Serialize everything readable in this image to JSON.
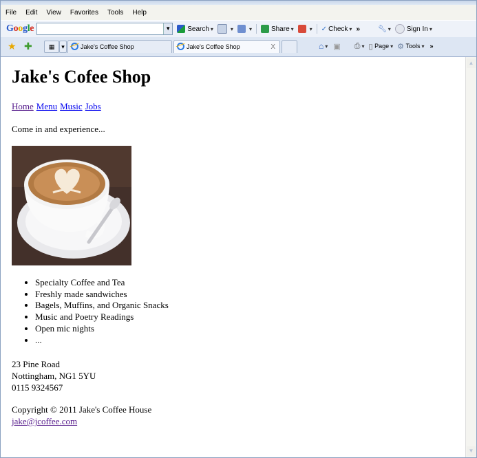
{
  "menu": [
    "File",
    "Edit",
    "View",
    "Favorites",
    "Tools",
    "Help"
  ],
  "google_toolbar": {
    "logo": [
      "G",
      "o",
      "o",
      "g",
      "l",
      "e"
    ],
    "search_label": "Search",
    "share_label": "Share",
    "check_label": "Check",
    "more_label": "»",
    "signin_label": "Sign In"
  },
  "tabs": [
    {
      "title": "Jake's Coffee Shop"
    },
    {
      "title": "Jake's Coffee Shop"
    }
  ],
  "tab_close": "X",
  "cmd": {
    "page_label": "Page",
    "tools_label": "Tools",
    "more_label": "»"
  },
  "page": {
    "heading": "Jake's Cofee Shop",
    "nav": [
      "Home",
      "Menu",
      "Music",
      "Jobs"
    ],
    "intro": "Come in and experience...",
    "features": [
      "Specialty Coffee and Tea",
      "Freshly made sandwiches",
      "Bagels, Muffins, and Organic Snacks",
      "Music and Poetry Readings",
      "Open mic nights",
      "..."
    ],
    "address": [
      "23 Pine Road",
      "Nottingham, NG1 5YU",
      "0115 9324567"
    ],
    "copyright": "Copyright © 2011 Jake's Coffee House",
    "email": "jake@jcoffee.com"
  },
  "colors": {
    "visited_link": "#551a8b",
    "link": "#0000ee",
    "coffee_bg": "#43302a"
  },
  "icons": {
    "favorites_star": "favorites-star-icon",
    "add_favorite": "add-favorite-icon",
    "home": "home-icon",
    "feeds": "feeds-icon",
    "print": "print-icon",
    "tools": "gear-icon"
  }
}
